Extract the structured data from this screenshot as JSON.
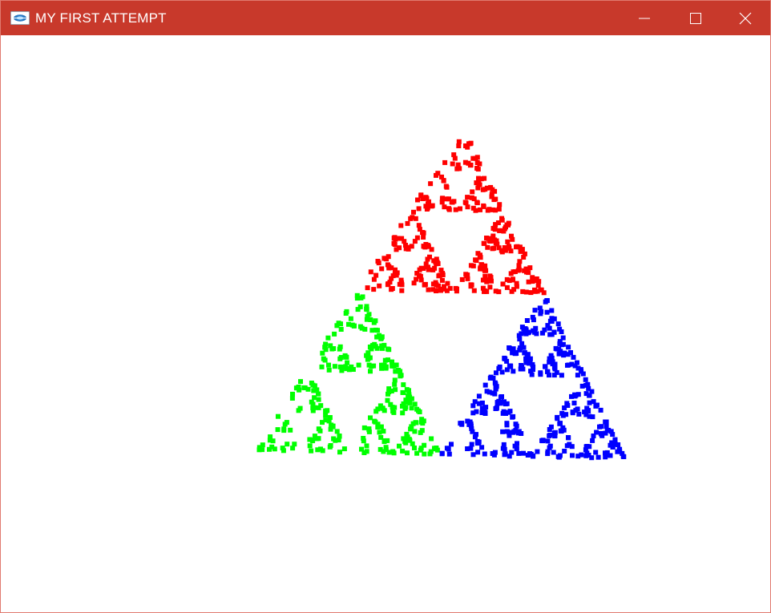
{
  "window": {
    "title": "MY FIRST ATTEMPT",
    "titlebar_color": "#c8392b",
    "border_color": "#e07a6f",
    "controls": {
      "minimize_icon": "minimize-icon",
      "maximize_icon": "maximize-icon",
      "close_icon": "close-icon"
    }
  },
  "canvas": {
    "background": "#ffffff",
    "figure": "sierpinski-triangle",
    "colors": {
      "top": "#ff0000",
      "left": "#00ff00",
      "right": "#0000ff"
    }
  }
}
